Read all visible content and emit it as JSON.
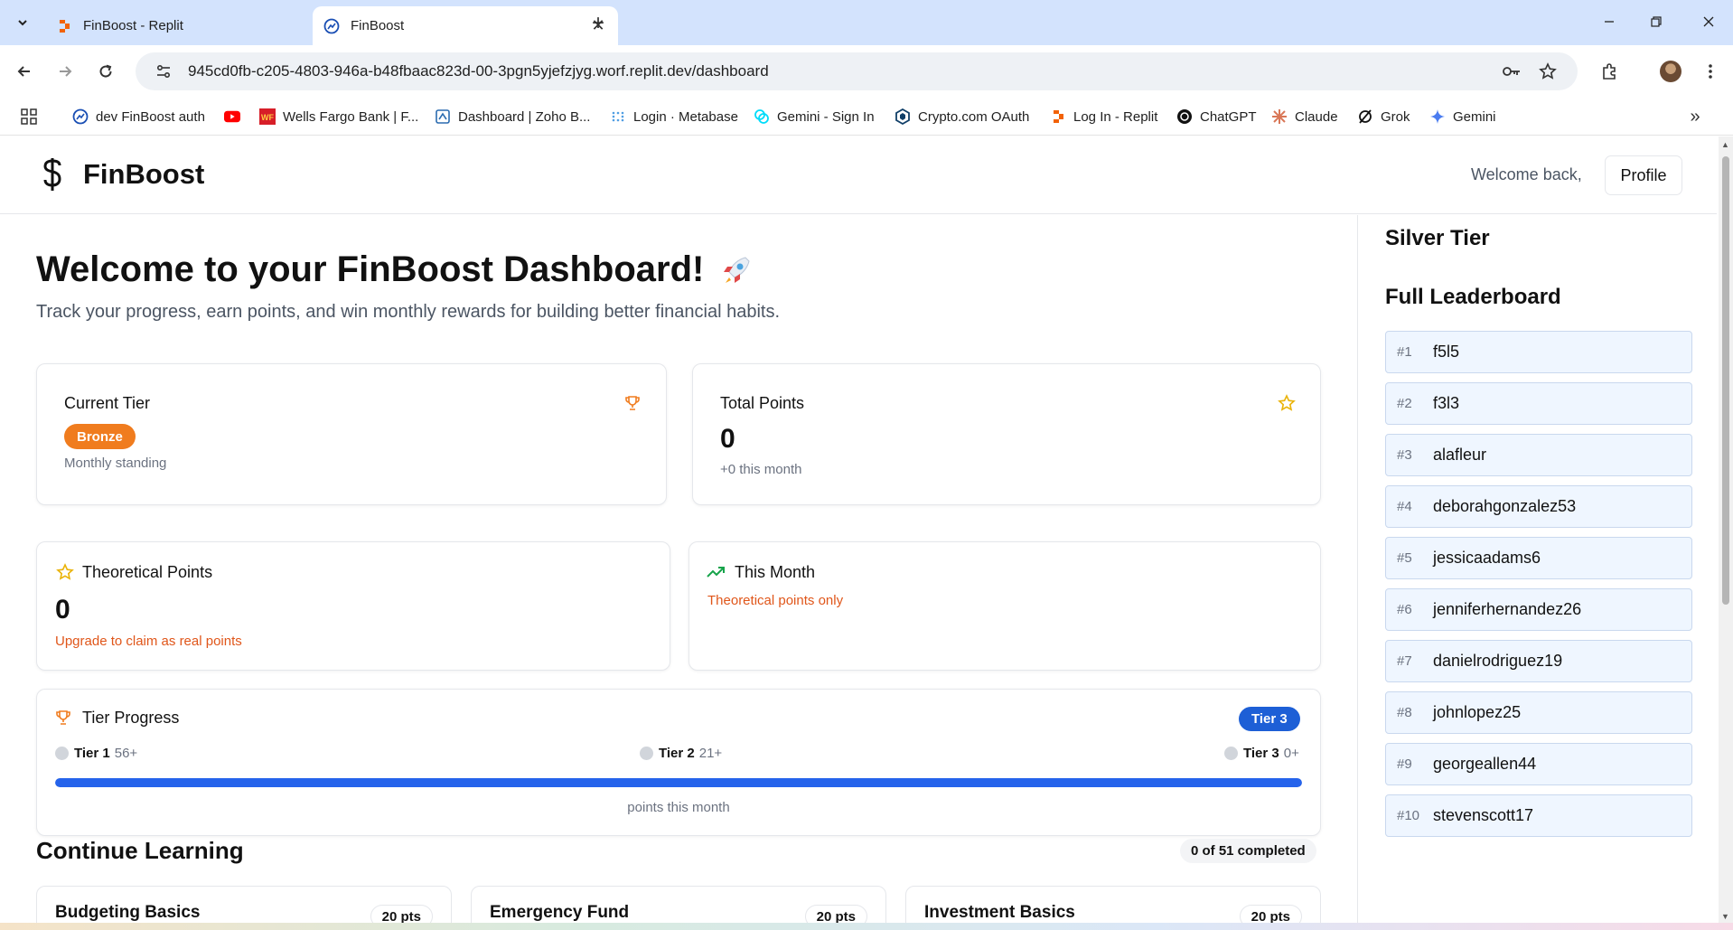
{
  "browser": {
    "tabs": [
      {
        "title": "FinBoost - Replit",
        "active": false,
        "icon": "replit-icon"
      },
      {
        "title": "FinBoost",
        "active": true,
        "icon": "finboost-favicon"
      }
    ],
    "url": "945cd0fb-c205-4803-946a-b48fbaac823d-00-3pgn5yjefzjyg.worf.replit.dev/dashboard",
    "bookmarks": [
      {
        "label": "dev FinBoost auth",
        "icon": "finboost-favicon"
      },
      {
        "label": "",
        "icon": "youtube-icon"
      },
      {
        "label": "Wells Fargo Bank | F...",
        "icon": "wells-fargo-icon"
      },
      {
        "label": "Dashboard | Zoho B...",
        "icon": "zoho-icon"
      },
      {
        "label": "Login · Metabase",
        "icon": "metabase-icon"
      },
      {
        "label": "Gemini - Sign In",
        "icon": "gemini-exchange-icon"
      },
      {
        "label": "Crypto.com OAuth",
        "icon": "crypto-com-icon"
      },
      {
        "label": "Log In - Replit",
        "icon": "replit-icon"
      },
      {
        "label": "ChatGPT",
        "icon": "chatgpt-icon"
      },
      {
        "label": "Claude",
        "icon": "claude-icon"
      },
      {
        "label": "Grok",
        "icon": "grok-icon"
      },
      {
        "label": "Gemini",
        "icon": "gemini-icon"
      }
    ]
  },
  "header": {
    "brand": "FinBoost",
    "welcome": "Welcome back,",
    "profile_label": "Profile"
  },
  "main": {
    "title": "Welcome to your FinBoost Dashboard!",
    "subtitle": "Track your progress, earn points, and win monthly rewards for building better financial habits.",
    "current_tier": {
      "title": "Current Tier",
      "badge": "Bronze",
      "caption": "Monthly standing"
    },
    "total_points": {
      "title": "Total Points",
      "value": "0",
      "caption": "+0 this month"
    },
    "theoretical_points": {
      "title": "Theoretical Points",
      "value": "0",
      "caption": "Upgrade to claim as real points"
    },
    "this_month": {
      "title": "This Month",
      "caption": "Theoretical points only"
    },
    "tier_progress": {
      "title": "Tier Progress",
      "current": "Tier 3",
      "tiers": [
        {
          "name": "Tier 1",
          "points": "56+"
        },
        {
          "name": "Tier 2",
          "points": "21+"
        },
        {
          "name": "Tier 3",
          "points": "0+"
        }
      ],
      "progress_percent": 100,
      "caption": "points this month"
    },
    "learning": {
      "title": "Continue Learning",
      "completed": "0 of 51 completed",
      "courses": [
        {
          "name": "Budgeting Basics",
          "points": "20 pts"
        },
        {
          "name": "Emergency Fund",
          "points": "20 pts"
        },
        {
          "name": "Investment Basics",
          "points": "20 pts"
        }
      ]
    }
  },
  "sidebar": {
    "tier_title": "Silver Tier",
    "leaderboard_title": "Full Leaderboard",
    "leaderboard": [
      {
        "rank": "#1",
        "name": "f5l5"
      },
      {
        "rank": "#2",
        "name": "f3l3"
      },
      {
        "rank": "#3",
        "name": "alafleur"
      },
      {
        "rank": "#4",
        "name": "deborahgonzalez53"
      },
      {
        "rank": "#5",
        "name": "jessicaadams6"
      },
      {
        "rank": "#6",
        "name": "jenniferhernandez26"
      },
      {
        "rank": "#7",
        "name": "danielrodriguez19"
      },
      {
        "rank": "#8",
        "name": "johnlopez25"
      },
      {
        "rank": "#9",
        "name": "georgeallen44"
      },
      {
        "rank": "#10",
        "name": "stevenscott17"
      }
    ]
  },
  "colors": {
    "accent_orange": "#f07c1e",
    "accent_blue": "#2563eb",
    "warning_text": "#e0561a",
    "success_green": "#16a34a",
    "star_yellow": "#eab308"
  }
}
